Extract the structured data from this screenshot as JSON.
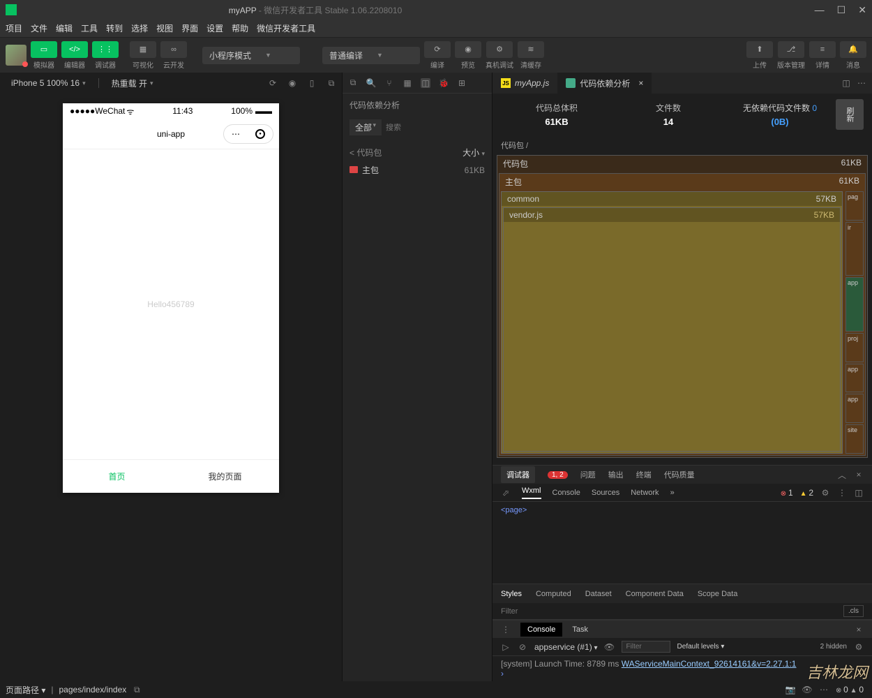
{
  "title": {
    "app": "myAPP",
    "suffix": " - 微信开发者工具 Stable 1.06.2208010"
  },
  "menu": [
    "项目",
    "文件",
    "编辑",
    "工具",
    "转到",
    "选择",
    "视图",
    "界面",
    "设置",
    "帮助",
    "微信开发者工具"
  ],
  "toolbar": {
    "sim": "模拟器",
    "editor": "编辑器",
    "debugger": "调试器",
    "visual": "可视化",
    "cloud": "云开发",
    "mode": "小程序模式",
    "compile": "普通编译",
    "compileBtn": "编译",
    "preview": "预览",
    "realDevice": "真机调试",
    "clearCache": "清缓存",
    "upload": "上传",
    "version": "版本管理",
    "details": "详情",
    "message": "消息"
  },
  "simbar": {
    "device": "iPhone 5 100% 16",
    "reload": "热重载 开"
  },
  "phone": {
    "carrier": "WeChat",
    "time": "11:43",
    "battery": "100%",
    "navTitle": "uni-app",
    "body": "Hello456789",
    "tab1": "首页",
    "tab2": "我的页面"
  },
  "mid": {
    "title": "代码依赖分析",
    "filter": "全部",
    "search": "搜索",
    "pkgBack": "< 代码包",
    "sizeHdr": "大小",
    "mainPkg": "主包",
    "mainSize": "61KB"
  },
  "tabs": {
    "file1": "myApp.js",
    "file2": "代码依赖分析"
  },
  "analysis": {
    "totalLbl": "代码总体积",
    "totalVal": "61KB",
    "filesLbl": "文件数",
    "filesVal": "14",
    "noDepsLbl": "无依赖代码文件数",
    "noDepsCount": "0",
    "noDepsSize": "(0B)",
    "refresh": "刷新",
    "breadcrumb": "代码包 /",
    "root": {
      "name": "代码包",
      "size": "61KB"
    },
    "main": {
      "name": "主包",
      "size": "61KB"
    },
    "common": {
      "name": "common",
      "size": "57KB"
    },
    "vendor": {
      "name": "vendor.js",
      "size": "57KB"
    },
    "side": [
      "pag",
      "ir",
      "app",
      "proj",
      "app",
      "app",
      "site"
    ]
  },
  "dev": {
    "toptabs": {
      "debugger": "调试器",
      "badge": "1, 2",
      "issues": "问题",
      "output": "输出",
      "terminal": "终端",
      "quality": "代码质量"
    },
    "subtabs": [
      "Wxml",
      "Console",
      "Sources",
      "Network"
    ],
    "errors": "1",
    "warnings": "2",
    "pageTag": "<page>",
    "styleTabs": [
      "Styles",
      "Computed",
      "Dataset",
      "Component Data",
      "Scope Data"
    ],
    "filterPh": "Filter",
    "cls": ".cls",
    "consoleTabs": [
      "Console",
      "Task"
    ],
    "context": "appservice (#1)",
    "levels": "Default levels ▾",
    "hidden": "2 hidden",
    "log": {
      "prefix": "[system] Launch Time: 8789 ms ",
      "link": "WAServiceMainContext_92614161&v=2.27.1:1"
    }
  },
  "footer": {
    "pathLbl": "页面路径",
    "path": "pages/index/index",
    "err": "0",
    "warn": "0"
  },
  "watermark": "吉林龙网"
}
